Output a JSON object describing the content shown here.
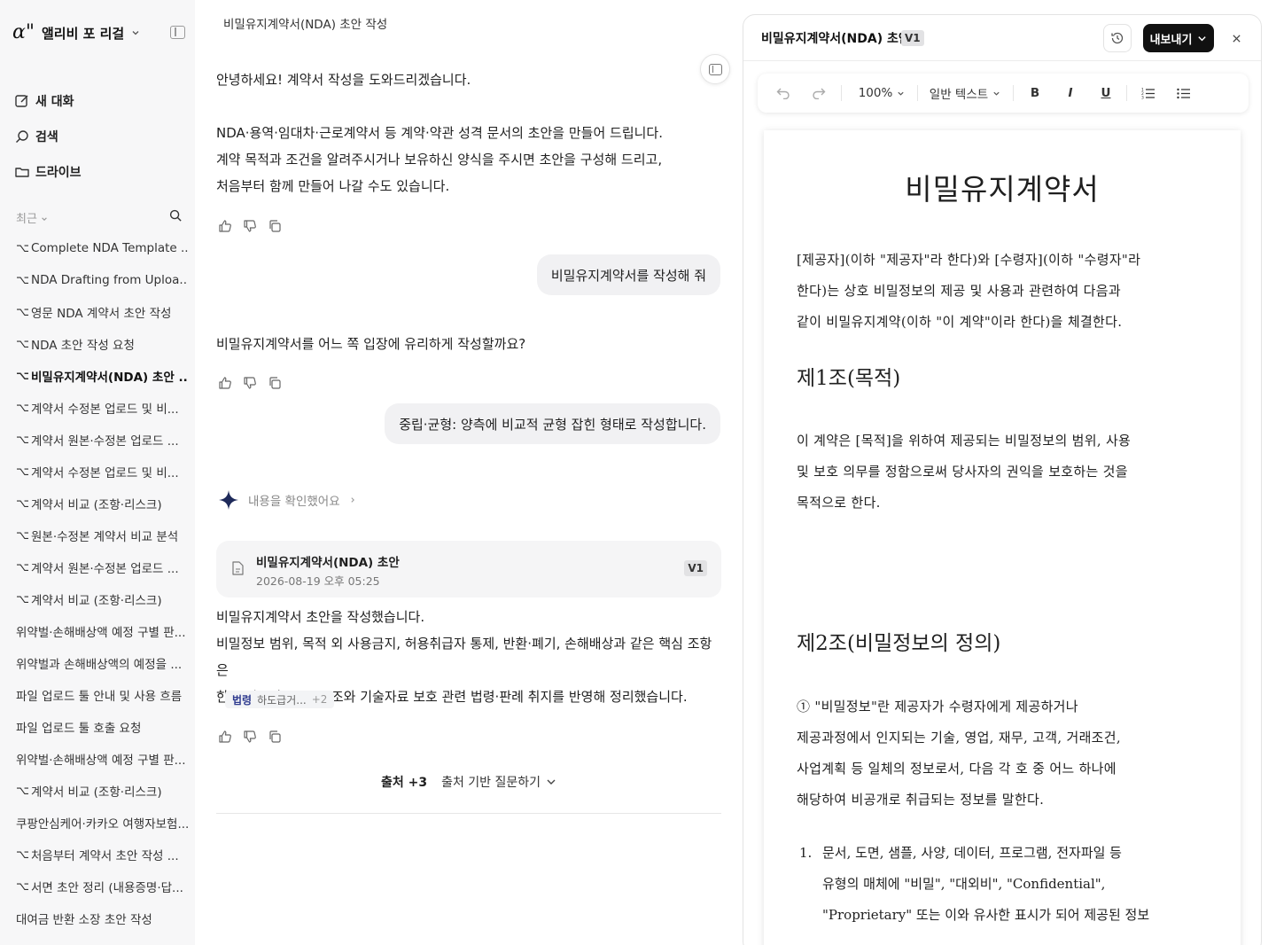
{
  "sidebar": {
    "brand_logo": "α\"",
    "brand_name": "앨리비 포 리걸",
    "nav": [
      {
        "label": "새 대화",
        "icon": "new-chat-icon"
      },
      {
        "label": "검색",
        "icon": "search-icon"
      },
      {
        "label": "드라이브",
        "icon": "folder-icon"
      }
    ],
    "recent_label": "최근",
    "recent": [
      {
        "prefix": "⌥",
        "label": "Complete NDA Template ..."
      },
      {
        "prefix": "⌥",
        "label": "NDA Drafting from Uploa..."
      },
      {
        "prefix": "⌥",
        "label": "영문 NDA 계약서 초안 작성"
      },
      {
        "prefix": "⌥",
        "label": "NDA 초안 작성 요청"
      },
      {
        "prefix": "⌥",
        "label": "비밀유지계약서(NDA) 초안 ..."
      },
      {
        "prefix": "⌥",
        "label": "계약서 수정본 업로드 및 비..."
      },
      {
        "prefix": "⌥",
        "label": "계약서 원본·수정본 업로드 ..."
      },
      {
        "prefix": "⌥",
        "label": "계약서 수정본 업로드 및 비..."
      },
      {
        "prefix": "⌥",
        "label": "계약서 비교 (조항·리스크)"
      },
      {
        "prefix": "⌥",
        "label": "원본·수정본 계약서 비교 분석"
      },
      {
        "prefix": "⌥",
        "label": "계약서 원본·수정본 업로드 ..."
      },
      {
        "prefix": "⌥",
        "label": "계약서 비교 (조항·리스크)"
      },
      {
        "prefix": "",
        "label": "위약벌·손해배상액 예정 구별 판..."
      },
      {
        "prefix": "",
        "label": "위약벌과 손해배상액의 예정을 ..."
      },
      {
        "prefix": "",
        "label": "파일 업로드 툴 안내 및 사용 흐름"
      },
      {
        "prefix": "",
        "label": "파일 업로드 툴 호출 요청"
      },
      {
        "prefix": "",
        "label": "위약벌·손해배상액 예정 구별 판..."
      },
      {
        "prefix": "⌥",
        "label": "계약서 비교 (조항·리스크)"
      },
      {
        "prefix": "",
        "label": "쿠팡안심케어·카카오 여행자보험..."
      },
      {
        "prefix": "⌥",
        "label": "처음부터 계약서 초안 작성 ..."
      },
      {
        "prefix": "⌥",
        "label": "서면 초안 정리 (내용증명·답..."
      },
      {
        "prefix": "",
        "label": "대여금 반환 소장 초안 작성"
      }
    ]
  },
  "chat": {
    "title": "비밀유지계약서(NDA) 초안 작성",
    "assistant1": [
      "안녕하세요! 계약서 작성을 도와드리겠습니다.",
      "",
      "NDA·용역·임대차·근로계약서 등 계약·약관 성격 문서의 초안을 만들어 드립니다.",
      "계약 목적과 조건을 알려주시거나 보유하신 양식을 주시면 초안을 구성해 드리고,",
      "처음부터 함께 만들어 나갈 수도 있습니다."
    ],
    "user1": "비밀유지계약서를 작성해 줘",
    "assistant2": "비밀유지계약서를 어느 쪽 입장에 유리하게 작성할까요?",
    "user2": "중립·균형: 양측에 비교적 균형 잡힌 형태로 작성합니다.",
    "thinking": "내용을 확인했어요",
    "doc_card": {
      "name": "비밀유지계약서(NDA) 초안",
      "date": "2026-08-19 오후 05:25",
      "version": "V1"
    },
    "assistant3": [
      "비밀유지계약서 초안을 작성했습니다.",
      "비밀정보 범위, 목적 외 사용금지, 허용취급자 통제, 반환·폐기, 손해배상과 같은 핵심 조항은",
      "한국 실무상 NDA 구조와 기술자료 보호 관련 법령·판례 취지를 반영해 정리했습니다."
    ],
    "source_tag": {
      "kind": "법령",
      "text": "하도급거...",
      "more": "+2"
    },
    "sources_count": "출처 +3",
    "sources_ask": "출처 기반 질문하기"
  },
  "panel": {
    "title": "비밀유지계약서(NDA) 초안",
    "version": "V1",
    "export_label": "내보내기",
    "toolbar": {
      "zoom": "100%",
      "style": "일반 텍스트",
      "bold": "B",
      "italic": "I",
      "underline": "U"
    },
    "doc": {
      "title": "비밀유지계약서",
      "preamble": [
        "[제공자](이하 \"제공자\"라 한다)와 [수령자](이하 \"수령자\"라",
        "한다)는 상호 비밀정보의 제공 및 사용과 관련하여 다음과",
        "같이 비밀유지계약(이하 \"이 계약\"이라 한다)을 체결한다."
      ],
      "art1_title": "제1조(목적)",
      "art1_body": [
        "이 계약은 [목적]을 위하여 제공되는 비밀정보의 범위, 사용",
        "및 보호 의무를 정함으로써 당사자의 권익을 보호하는 것을",
        "목적으로 한다."
      ],
      "art2_title": "제2조(비밀정보의 정의)",
      "art2_body": [
        "① \"비밀정보\"란 제공자가 수령자에게 제공하거나",
        "제공과정에서 인지되는 기술, 영업, 재무, 고객, 거래조건,",
        "사업계획 등 일체의 정보로서, 다음 각 호 중 어느 하나에",
        "해당하여 비공개로 취급되는 정보를 말한다."
      ],
      "art2_item1_num": "1.",
      "art2_item1": [
        "문서, 도면, 샘플, 사양, 데이터, 프로그램, 전자파일 등",
        "유형의 매체에 \"비밀\", \"대외비\", \"Confidential\",",
        "\"Proprietary\" 또는 이와 유사한 표시가 되어 제공된 정보"
      ]
    }
  }
}
